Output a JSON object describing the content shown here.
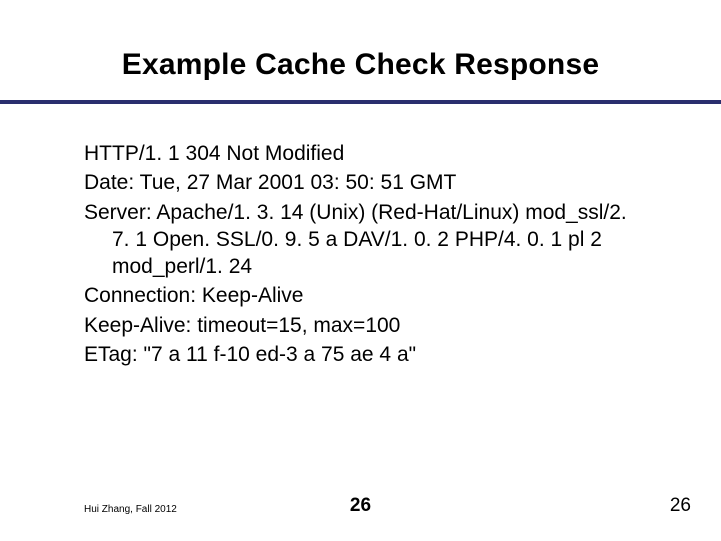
{
  "title": "Example Cache Check Response",
  "lines": {
    "l0": "HTTP/1. 1 304 Not Modified",
    "l1": "Date: Tue, 27 Mar 2001 03: 50: 51 GMT",
    "l2": "Server: Apache/1. 3. 14 (Unix)  (Red-Hat/Linux) mod_ssl/2. 7. 1 Open. SSL/0. 9. 5 a DAV/1. 0. 2 PHP/4. 0. 1 pl 2 mod_perl/1. 24",
    "l3": "Connection: Keep-Alive",
    "l4": "Keep-Alive: timeout=15, max=100",
    "l5": "ETag: \"7 a 11 f-10 ed-3 a 75 ae 4 a\""
  },
  "footer": {
    "left": "Hui Zhang, Fall 2012",
    "center_page": "26",
    "right_page": "26"
  }
}
